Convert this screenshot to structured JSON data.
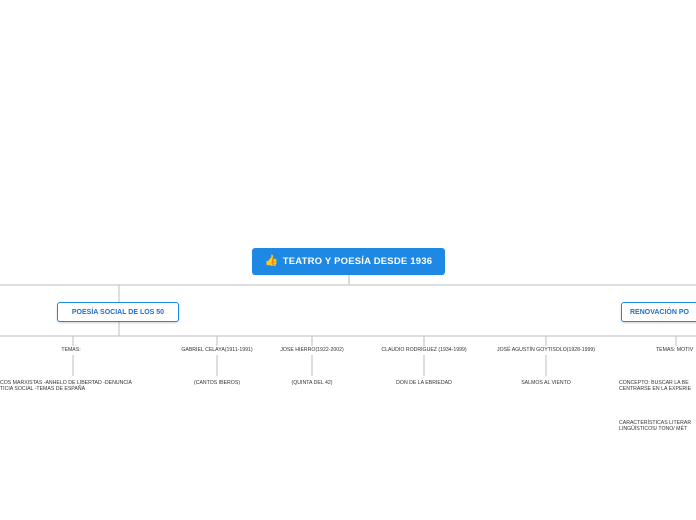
{
  "root": {
    "title": "TEATRO Y POESÍA DESDE 1936",
    "icon": "thumbs-up-icon"
  },
  "branches": [
    {
      "title": "POESÍA SOCIAL DE LOS 50",
      "children": [
        {
          "label": "TEMAS:",
          "detail_lines": [
            "COS MARXISTAS  -ANHELO DE LIBERTAD -DENUNCIA",
            "TICIA SOCIAL -TEMAS DE ESPAÑA"
          ]
        },
        {
          "label": "GABRIEL CELAYA(1911-1991)",
          "detail": "(CANTOS IBEROS)"
        },
        {
          "label": "JOSE HIERRO(1922-2002)",
          "detail": "(QUINTA DEL 42)"
        }
      ]
    },
    {
      "title": "RENOVACIÓN PO",
      "children": [
        {
          "label": "CLAUDIO RODRÍGUEZ (1934-1999)",
          "detail": "DON DE LA EBRIEDAD"
        },
        {
          "label": "JOSÉ AGUSTÍN GOYTISOLO(1928-1999)",
          "detail": "SALMOS AL VIENTO"
        },
        {
          "label": "TEMAS: MOTIV",
          "detail_lines": [
            "CONCEPTO: BUSCAR LA BE",
            "CENTRARSE EN LA EXPERIE"
          ],
          "detail2_lines": [
            "CARACTERÍSTICAS LITERAR",
            "LINGÜÍSTICOS/ TONO/ MÉT"
          ]
        }
      ]
    }
  ],
  "colors": {
    "accent": "#1e88e5",
    "connector": "#c9c9c9"
  }
}
